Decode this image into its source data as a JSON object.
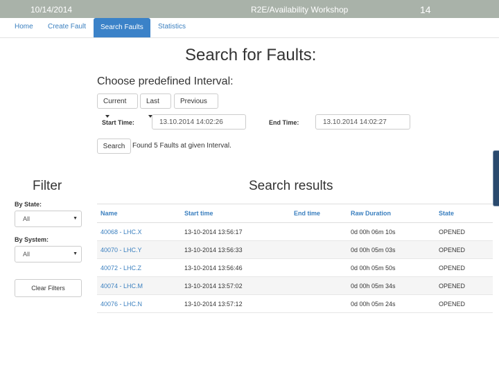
{
  "slide": {
    "date": "10/14/2014",
    "title": "R2E/Availability Workshop",
    "page_number": "14"
  },
  "nav": {
    "items": [
      {
        "label": "Home"
      },
      {
        "label": "Create Fault"
      },
      {
        "label": "Search Faults",
        "active": true
      },
      {
        "label": "Statistics"
      }
    ]
  },
  "search": {
    "heading": "Search for Faults:",
    "interval_heading": "Choose predefined Interval:",
    "interval_buttons": [
      {
        "label": "Current"
      },
      {
        "label": "Last"
      },
      {
        "label": "Previous"
      }
    ],
    "start_label": "Start Time:",
    "start_value": "13.10.2014 14:02:26",
    "end_label": "End Time:",
    "end_value": "13.10.2014 14:02:27",
    "search_button": "Search",
    "result_message": "Found 5 Faults at given Interval."
  },
  "filter": {
    "heading": "Filter",
    "state_label": "By State:",
    "state_value": "All",
    "system_label": "By System:",
    "system_value": "All",
    "clear_button": "Clear Filters"
  },
  "results": {
    "heading": "Search results",
    "columns": [
      "Name",
      "Start time",
      "End time",
      "Raw Duration",
      "State"
    ],
    "rows": [
      [
        "40068 - LHC.X",
        "13-10-2014 13:56:17",
        "",
        "0d 00h 06m 10s",
        "OPENED"
      ],
      [
        "40070 - LHC.Y",
        "13-10-2014 13:56:33",
        "",
        "0d 00h 05m 03s",
        "OPENED"
      ],
      [
        "40072 - LHC.Z",
        "13-10-2014 13:56:46",
        "",
        "0d 00h 05m 50s",
        "OPENED"
      ],
      [
        "40074 - LHC.M",
        "13-10-2014 13:57:02",
        "",
        "0d 00h 05m 34s",
        "OPENED"
      ],
      [
        "40076 - LHC.N",
        "13-10-2014 13:57:12",
        "",
        "0d 00h 05m 24s",
        "OPENED"
      ]
    ]
  },
  "colors": {
    "header_bar": "#a9b2a9",
    "nav_active": "#3b82c8",
    "link": "#3a7fbf"
  }
}
